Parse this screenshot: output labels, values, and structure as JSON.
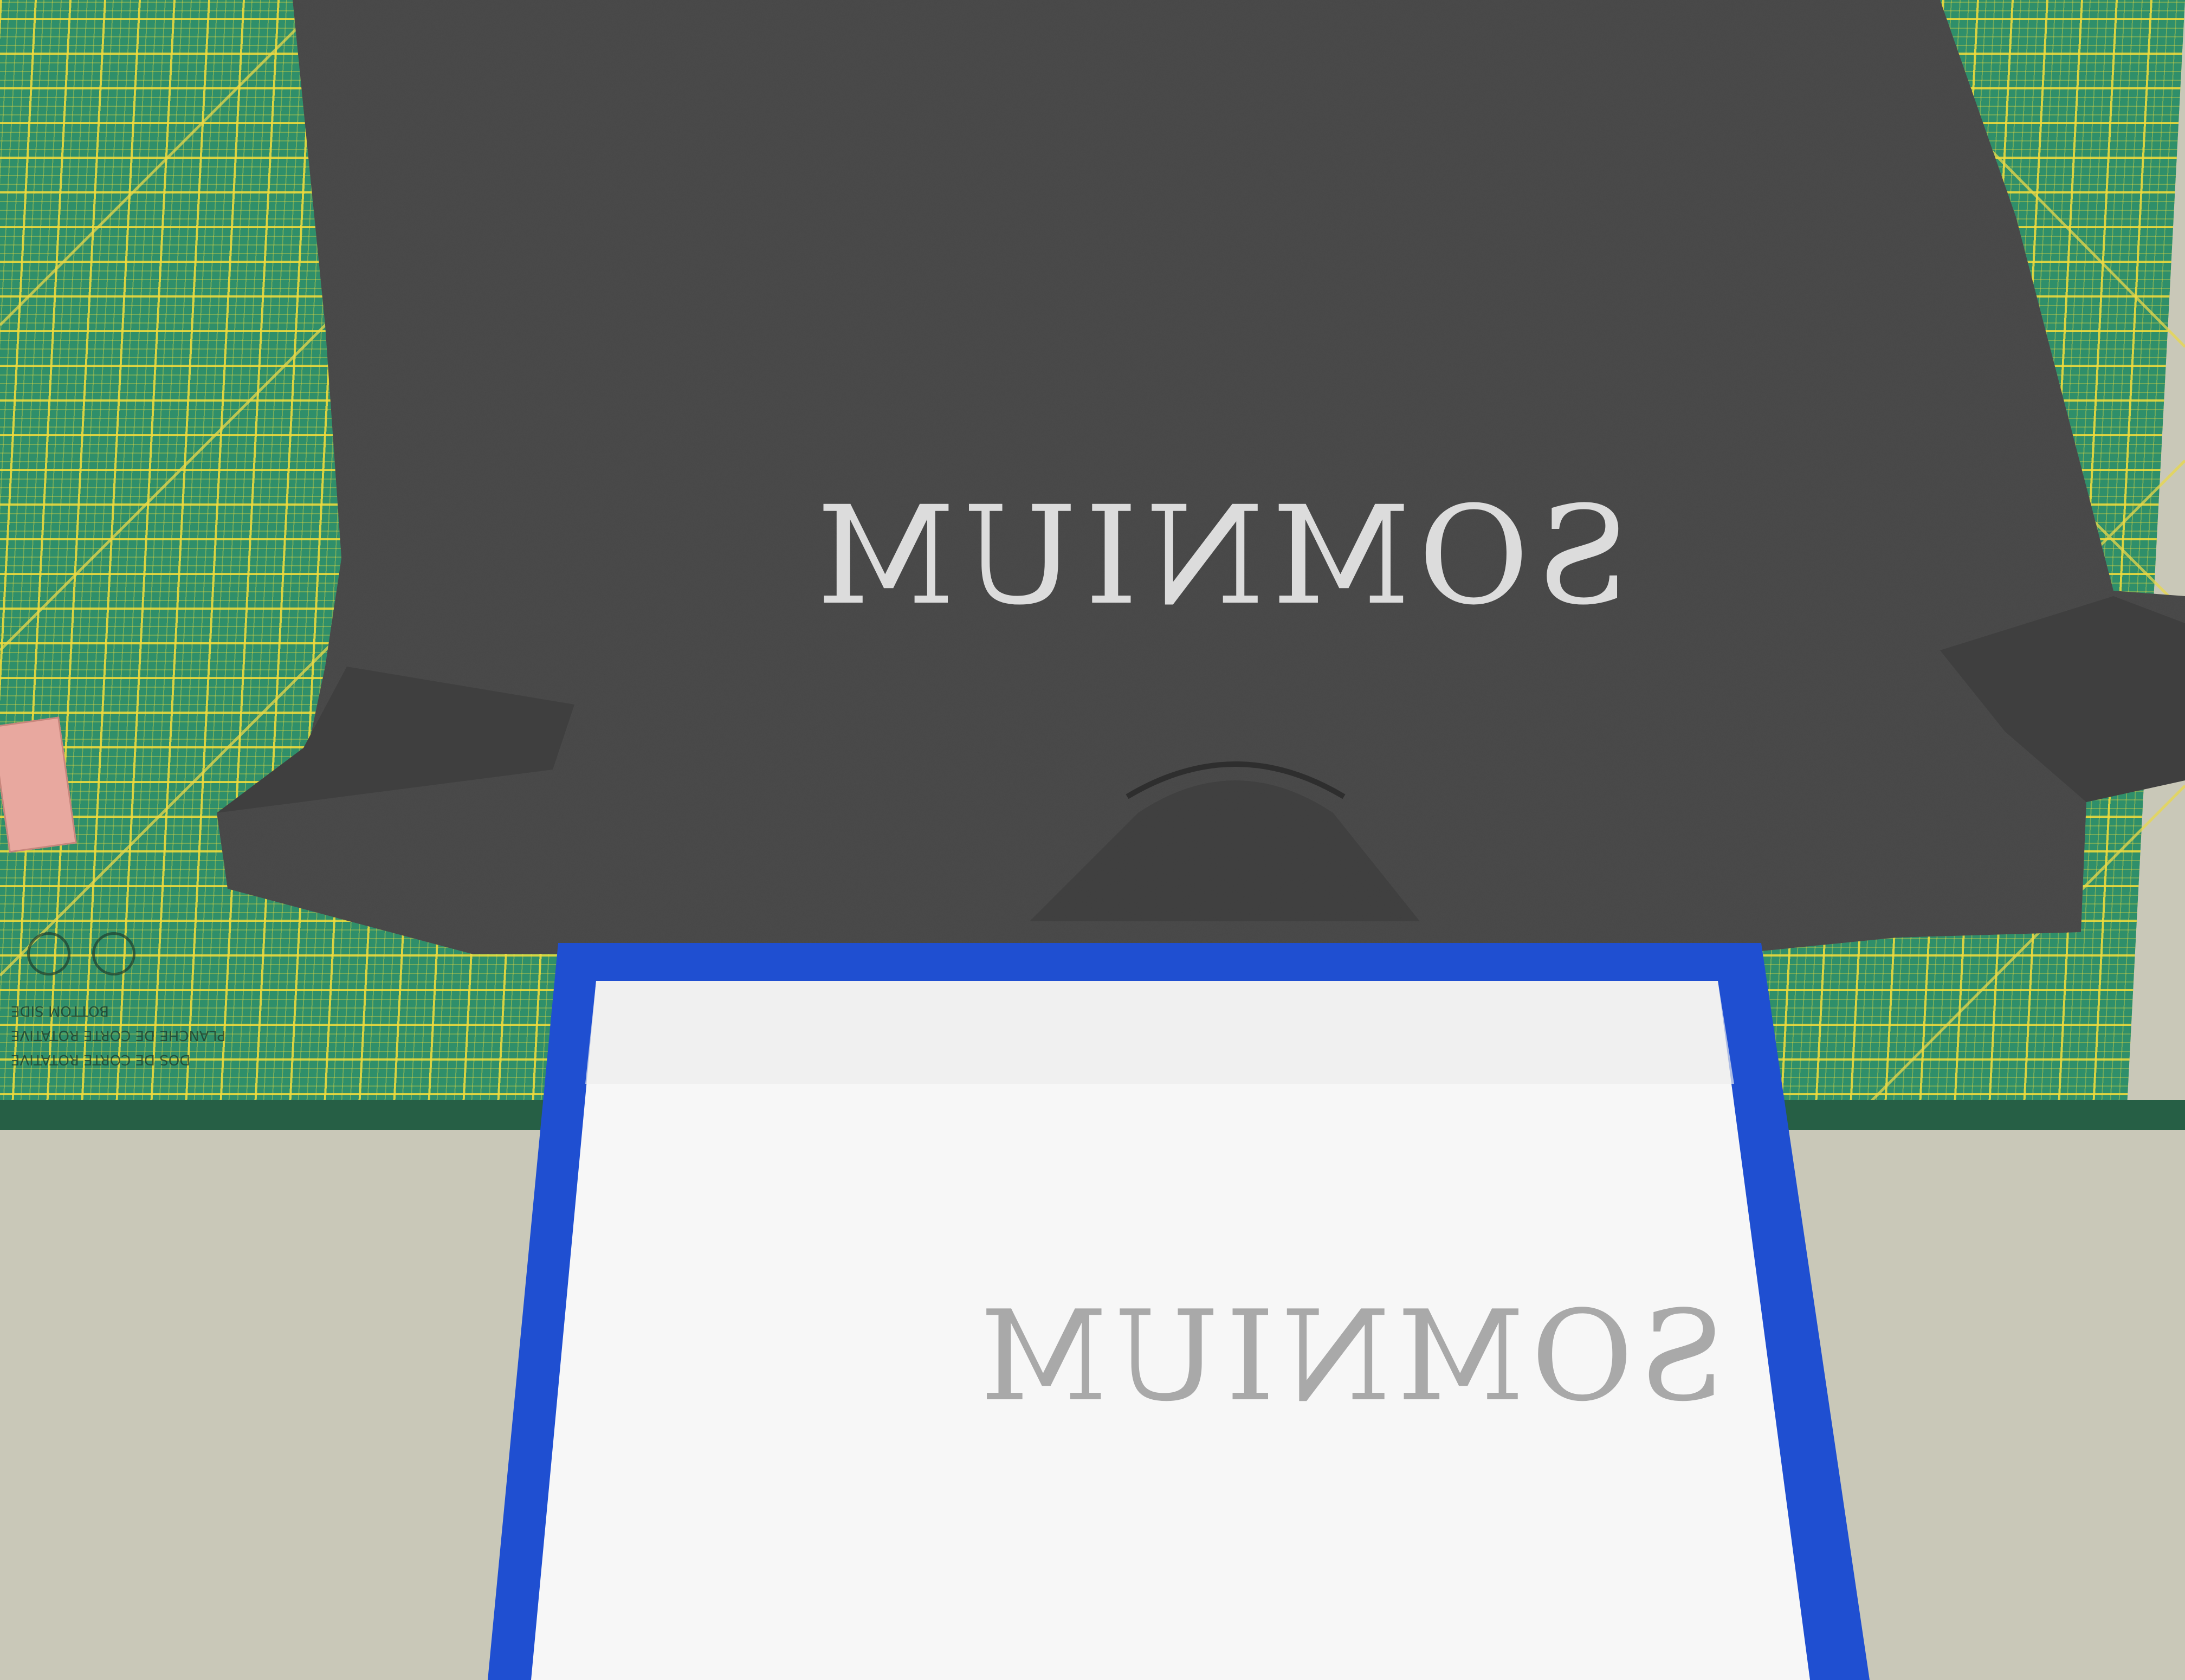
{
  "scene": {
    "shirt_print_text": "SOMNIUM",
    "board_stencil_text": "SOMNIUM",
    "mat_labels": [
      "BOTTOM SIDE",
      "PLANCHE DE CORTE ROTATIVE",
      "DOS DE CORTE ROTATIVE"
    ],
    "colors": {
      "mat_green": "#2f8f6a",
      "mat_grid_yellow": "#f0dc3c",
      "shirt_grey": "#4a4a4a",
      "tape_blue": "#1f4fd1",
      "paper_white": "#f7f7f7",
      "wall_beige": "#c9c8b8"
    }
  }
}
